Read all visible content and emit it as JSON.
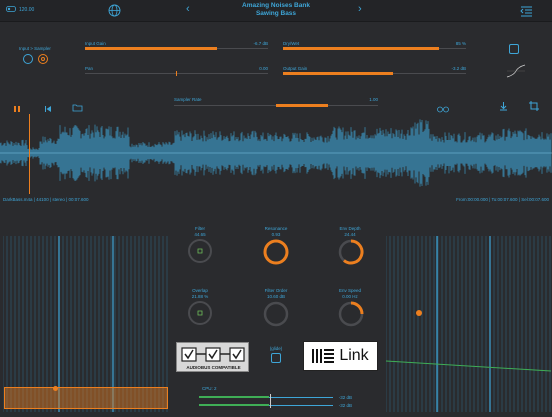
{
  "topbar": {
    "bpm": "120.00",
    "bank": "Amazing Noises Bank",
    "preset": "Sawing Bass"
  },
  "input": {
    "label": "Input > Sampler"
  },
  "params": {
    "input_gain": {
      "label": "Input Gain",
      "value": "-6.7 dB",
      "fraction": 0.72
    },
    "pan": {
      "label": "Pan",
      "value": "0.00",
      "fraction": 0.5
    },
    "dry_wet": {
      "label": "Dry/Wet",
      "value": "85 %",
      "fraction": 0.85
    },
    "output_gain": {
      "label": "Output Gain",
      "value": "-3.2 dB",
      "fraction": 0.82
    }
  },
  "sampler": {
    "label": "Sampler Rate",
    "value": "1.00",
    "fraction": 0.5
  },
  "file": {
    "info": "DarkBass.m4a | 44100 | stereo | 00:07.600",
    "positions": "From:00:00.000 | To:00:07.600 | Sel:00:07.600"
  },
  "knobs": {
    "filter": {
      "label": "Filter",
      "value": "44.65"
    },
    "resonance": {
      "label": "Resonance",
      "value": "0.93"
    },
    "env_depth": {
      "label": "Env Depth",
      "value": "24.44"
    },
    "overlap": {
      "label": "Overlap",
      "value": "21.88 %"
    },
    "filter_order": {
      "label": "Filter Order",
      "value": "10.60 dB"
    },
    "env_speed": {
      "label": "Env Speed",
      "value": "0.00 Hz"
    }
  },
  "logos": {
    "audiobus": "AUDIOBUS COMPATIBLE",
    "link": "Link",
    "glide": "(glide)"
  },
  "cpu": {
    "label": "CPU: 2"
  },
  "meters": {
    "left": "-32 dB",
    "right": "-32 dB"
  },
  "colors": {
    "accent": "#ec7f1f",
    "blue": "#3ea6d8",
    "bg": "#2a2b2e"
  }
}
